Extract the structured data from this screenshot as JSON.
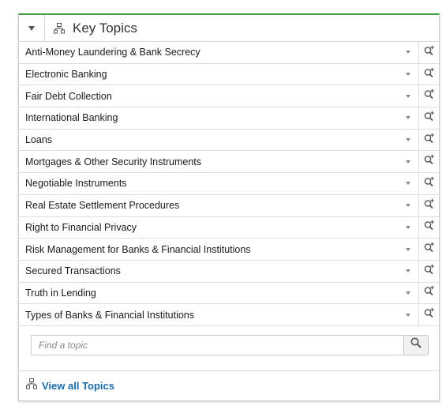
{
  "panel": {
    "title": "Key Topics",
    "accent_color": "#3e9b3e",
    "collapse_icon": "triangle-down-icon",
    "title_icon": "hierarchy-icon"
  },
  "topics": [
    {
      "label": "Anti-Money Laundering & Bank Secrecy"
    },
    {
      "label": "Electronic Banking"
    },
    {
      "label": "Fair Debt Collection"
    },
    {
      "label": "International Banking"
    },
    {
      "label": "Loans"
    },
    {
      "label": "Mortgages & Other Security Instruments"
    },
    {
      "label": "Negotiable Instruments"
    },
    {
      "label": "Real Estate Settlement Procedures"
    },
    {
      "label": "Right to Financial Privacy"
    },
    {
      "label": "Risk Management for Banks & Financial Institutions"
    },
    {
      "label": "Secured Transactions"
    },
    {
      "label": "Truth in Lending"
    },
    {
      "label": "Types of Banks & Financial Institutions"
    }
  ],
  "search": {
    "placeholder": "Find a topic",
    "value": "",
    "icon": "search-icon"
  },
  "footer": {
    "link_label": "View all Topics",
    "link_color": "#1a6aa8",
    "icon": "hierarchy-icon"
  }
}
